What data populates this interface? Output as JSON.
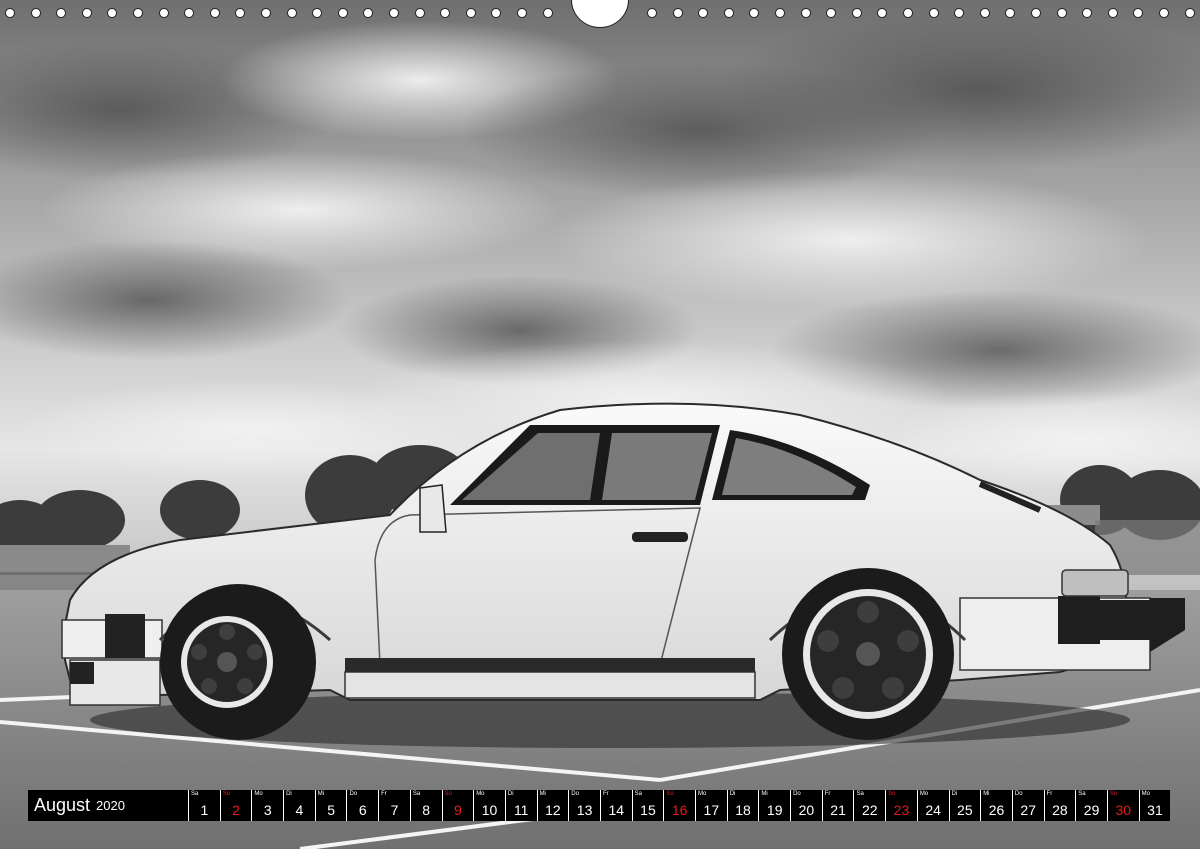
{
  "calendar": {
    "month": "August",
    "year": "2020",
    "days": [
      {
        "wd": "Sa",
        "num": "1",
        "sunday": false
      },
      {
        "wd": "So",
        "num": "2",
        "sunday": true
      },
      {
        "wd": "Mo",
        "num": "3",
        "sunday": false
      },
      {
        "wd": "Di",
        "num": "4",
        "sunday": false
      },
      {
        "wd": "Mi",
        "num": "5",
        "sunday": false
      },
      {
        "wd": "Do",
        "num": "6",
        "sunday": false
      },
      {
        "wd": "Fr",
        "num": "7",
        "sunday": false
      },
      {
        "wd": "Sa",
        "num": "8",
        "sunday": false
      },
      {
        "wd": "So",
        "num": "9",
        "sunday": true
      },
      {
        "wd": "Mo",
        "num": "10",
        "sunday": false
      },
      {
        "wd": "Di",
        "num": "11",
        "sunday": false
      },
      {
        "wd": "Mi",
        "num": "12",
        "sunday": false
      },
      {
        "wd": "Do",
        "num": "13",
        "sunday": false
      },
      {
        "wd": "Fr",
        "num": "14",
        "sunday": false
      },
      {
        "wd": "Sa",
        "num": "15",
        "sunday": false
      },
      {
        "wd": "So",
        "num": "16",
        "sunday": true
      },
      {
        "wd": "Mo",
        "num": "17",
        "sunday": false
      },
      {
        "wd": "Di",
        "num": "18",
        "sunday": false
      },
      {
        "wd": "Mi",
        "num": "19",
        "sunday": false
      },
      {
        "wd": "Do",
        "num": "20",
        "sunday": false
      },
      {
        "wd": "Fr",
        "num": "21",
        "sunday": false
      },
      {
        "wd": "Sa",
        "num": "22",
        "sunday": false
      },
      {
        "wd": "So",
        "num": "23",
        "sunday": true
      },
      {
        "wd": "Mo",
        "num": "24",
        "sunday": false
      },
      {
        "wd": "Di",
        "num": "25",
        "sunday": false
      },
      {
        "wd": "Mi",
        "num": "26",
        "sunday": false
      },
      {
        "wd": "Do",
        "num": "27",
        "sunday": false
      },
      {
        "wd": "Fr",
        "num": "28",
        "sunday": false
      },
      {
        "wd": "Sa",
        "num": "29",
        "sunday": false
      },
      {
        "wd": "So",
        "num": "30",
        "sunday": true
      },
      {
        "wd": "Mo",
        "num": "31",
        "sunday": false
      }
    ]
  },
  "colors": {
    "sunday": "#e21b1b",
    "strip_background": "#000000",
    "strip_text": "#ffffff"
  },
  "icons": {
    "binding": "binding-hole-icon",
    "hanger": "hanger-notch-icon"
  }
}
